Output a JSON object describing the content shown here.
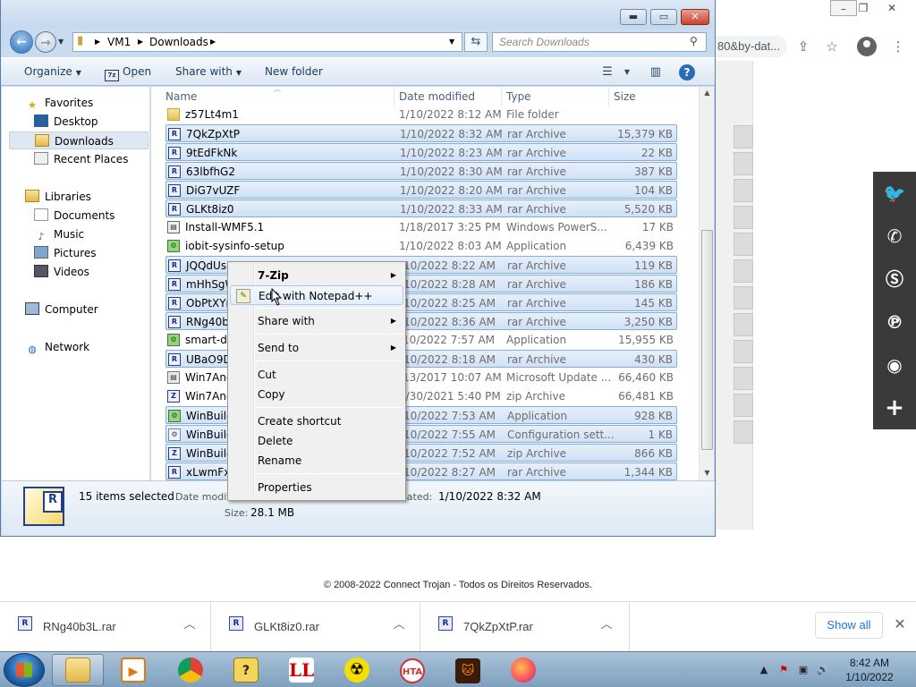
{
  "chrome": {
    "url_fragment": "80&by-dat...",
    "footer": "© 2008-2022 Connect Trojan - Todos os Direitos Reservados."
  },
  "explorer": {
    "breadcrumbs": [
      "VM1",
      "Downloads"
    ],
    "search_placeholder": "Search Downloads",
    "toolbar": {
      "organize": "Organize",
      "open": "Open",
      "share_with": "Share with",
      "new_folder": "New folder"
    },
    "nav": {
      "favorites": "Favorites",
      "desktop": "Desktop",
      "downloads": "Downloads",
      "recent_places": "Recent Places",
      "libraries": "Libraries",
      "documents": "Documents",
      "music": "Music",
      "pictures": "Pictures",
      "videos": "Videos",
      "computer": "Computer",
      "network": "Network"
    },
    "columns": {
      "name": "Name",
      "date": "Date modified",
      "type": "Type",
      "size": "Size"
    },
    "files": [
      {
        "name": "z57Lt4m1",
        "date": "1/10/2022 8:12 AM",
        "type": "File folder",
        "size": "",
        "icon": "folder",
        "selected": false
      },
      {
        "name": "7QkZpXtP",
        "date": "1/10/2022 8:32 AM",
        "type": "rar Archive",
        "size": "15,379 KB",
        "icon": "rar",
        "selected": true
      },
      {
        "name": "9tEdFkNk",
        "date": "1/10/2022 8:23 AM",
        "type": "rar Archive",
        "size": "22 KB",
        "icon": "rar",
        "selected": true
      },
      {
        "name": "63lbfhG2",
        "date": "1/10/2022 8:30 AM",
        "type": "rar Archive",
        "size": "387 KB",
        "icon": "rar",
        "selected": true
      },
      {
        "name": "DiG7vUZF",
        "date": "1/10/2022 8:20 AM",
        "type": "rar Archive",
        "size": "104 KB",
        "icon": "rar",
        "selected": true
      },
      {
        "name": "GLKt8iz0",
        "date": "1/10/2022 8:33 AM",
        "type": "rar Archive",
        "size": "5,520 KB",
        "icon": "rar",
        "selected": true
      },
      {
        "name": "Install-WMF5.1",
        "date": "1/18/2017 3:25 PM",
        "type": "Windows PowerS...",
        "size": "17 KB",
        "icon": "ps",
        "selected": false
      },
      {
        "name": "iobit-sysinfo-setup",
        "date": "1/10/2022 8:03 AM",
        "type": "Application",
        "size": "6,439 KB",
        "icon": "app",
        "selected": false
      },
      {
        "name": "JQQdUsa",
        "date": "/10/2022 8:22 AM",
        "type": "rar Archive",
        "size": "119 KB",
        "icon": "rar",
        "selected": true
      },
      {
        "name": "mHhSgW",
        "date": "/10/2022 8:28 AM",
        "type": "rar Archive",
        "size": "186 KB",
        "icon": "rar",
        "selected": true
      },
      {
        "name": "ObPtXYr",
        "date": "/10/2022 8:25 AM",
        "type": "rar Archive",
        "size": "145 KB",
        "icon": "rar",
        "selected": true
      },
      {
        "name": "RNg40b3",
        "date": "/10/2022 8:36 AM",
        "type": "rar Archive",
        "size": "3,250 KB",
        "icon": "rar",
        "selected": true
      },
      {
        "name": "smart-de",
        "date": "/10/2022 7:57 AM",
        "type": "Application",
        "size": "15,955 KB",
        "icon": "app",
        "selected": false
      },
      {
        "name": "UBaO9Dv",
        "date": "/10/2022 8:18 AM",
        "type": "rar Archive",
        "size": "430 KB",
        "icon": "rar",
        "selected": true
      },
      {
        "name": "Win7And",
        "date": "/13/2017 10:07 AM",
        "type": "Microsoft Update ...",
        "size": "66,460 KB",
        "icon": "upd",
        "selected": false
      },
      {
        "name": "Win7And",
        "date": "2/30/2021 5:40 PM",
        "type": "zip Archive",
        "size": "66,481 KB",
        "icon": "zip",
        "selected": false
      },
      {
        "name": "WinBuild",
        "date": "/10/2022 7:53 AM",
        "type": "Application",
        "size": "928 KB",
        "icon": "app",
        "selected": true
      },
      {
        "name": "WinBuild",
        "date": "/10/2022 7:55 AM",
        "type": "Configuration sett...",
        "size": "1 KB",
        "icon": "cfg",
        "selected": true
      },
      {
        "name": "WinBuild",
        "date": "/10/2022 7:52 AM",
        "type": "zip Archive",
        "size": "866 KB",
        "icon": "zip",
        "selected": true
      },
      {
        "name": "xLwmFxK",
        "date": "/10/2022 8:27 AM",
        "type": "rar Archive",
        "size": "1,344 KB",
        "icon": "rar",
        "selected": true
      }
    ],
    "details": {
      "selected_count": "15 items selected",
      "date_label": "Date modifi",
      "created_label": "eated:",
      "created_value": "1/10/2022 8:32 AM",
      "size_label": "Size:",
      "size_value": "28.1 MB"
    }
  },
  "context_menu": {
    "items": {
      "seven_zip": "7-Zip",
      "edit_notepad": "Edit with Notepad++",
      "share_with": "Share with",
      "send_to": "Send to",
      "cut": "Cut",
      "copy": "Copy",
      "create_shortcut": "Create shortcut",
      "delete": "Delete",
      "rename": "Rename",
      "properties": "Properties"
    }
  },
  "downloads_bar": {
    "items": [
      "RNg40b3L.rar",
      "GLKt8iz0.rar",
      "7QkZpXtP.rar"
    ],
    "show_all": "Show all"
  },
  "taskbar": {
    "apps": [
      "Explorer",
      "Media Player",
      "Chrome",
      "Help",
      "LL",
      "Radioactive",
      "HTA",
      "Cat",
      "Firefox"
    ],
    "hta_label": "HTA",
    "ll_label": "LL",
    "clock_time": "8:42 AM",
    "clock_date": "1/10/2022"
  }
}
